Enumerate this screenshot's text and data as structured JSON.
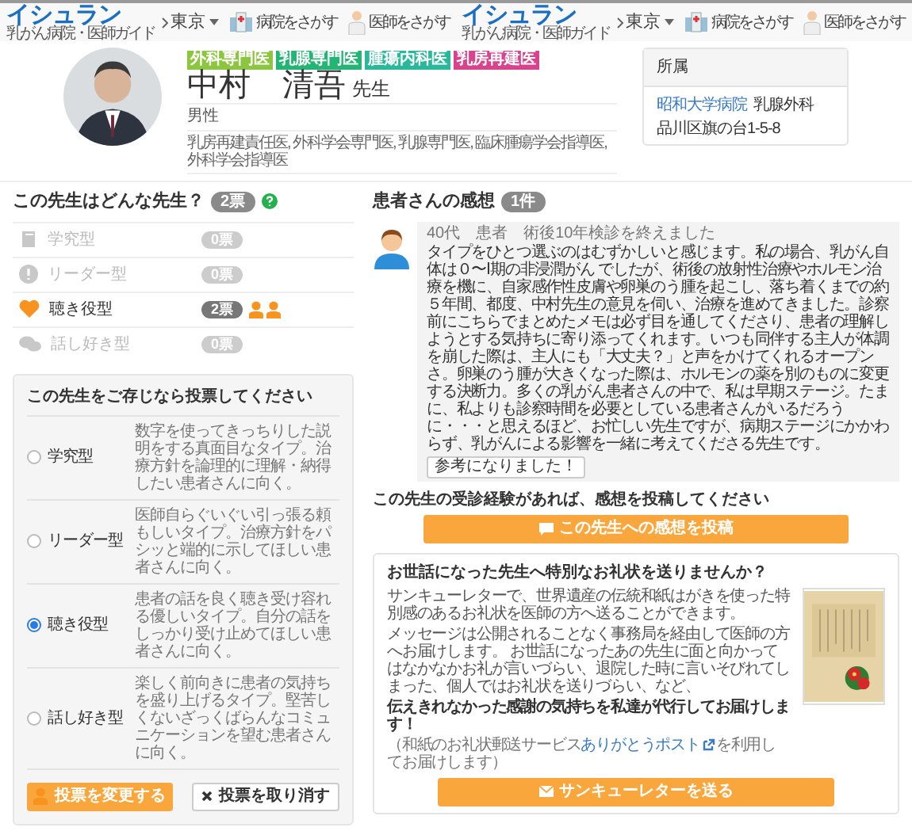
{
  "headers": [
    {
      "logo": "イシュラン",
      "tagline": "乳がん病院・医師ガイド",
      "region": "東京",
      "links": [
        "病院をさがす",
        "医師をさがす"
      ]
    },
    {
      "logo": "イシュラン",
      "tagline": "乳がん病院・医師ガイド",
      "region": "東京",
      "links": [
        "病院をさがす",
        "医師をさがす"
      ]
    }
  ],
  "profile": {
    "badges": [
      {
        "label": "外科専門医",
        "color": "#8cc63f"
      },
      {
        "label": "乳腺専門医",
        "color": "#22b573"
      },
      {
        "label": "腫瘍内科医",
        "color": "#29b89a"
      },
      {
        "label": "乳房再建医",
        "color": "#d9428c"
      }
    ],
    "name": "中村　清吾",
    "suffix": "先生",
    "gender": "男性",
    "qualifications": "乳房再建責任医, 外科学会専門医, 乳腺専門医, 臨床腫瘍学会指導医, 外科学会指導医"
  },
  "affiliation": {
    "title": "所属",
    "hospital": "昭和大学病院",
    "department": "乳腺外科",
    "address": "品川区旗の台1-5-8"
  },
  "types": {
    "title": "この先生はどんな先生？",
    "count": "2票",
    "items": [
      {
        "kind": "scholar",
        "label": "学究型",
        "count": "0票",
        "highlighted": false
      },
      {
        "kind": "leader",
        "label": "リーダー型",
        "count": "0票",
        "highlighted": false
      },
      {
        "kind": "listener",
        "label": "聴き役型",
        "count": "2票",
        "highlighted": true,
        "voters": [
          {
            "kind": "person"
          },
          {
            "kind": "person"
          }
        ]
      },
      {
        "kind": "talker",
        "label": "話し好き型",
        "count": "0票",
        "highlighted": false
      }
    ]
  },
  "vote": {
    "title": "この先生をご存じなら投票してください",
    "options": [
      {
        "label": "学究型",
        "description": "数字を使ってきっちりした説明をする真面目なタイプ。治療方針を論理的に理解・納得したい患者さんに向く。",
        "selected": false
      },
      {
        "label": "リーダー型",
        "description": "医師自らぐいぐい引っ張る頼もしいタイプ。治療方針をパシッと端的に示してほしい患者さんに向く。",
        "selected": false
      },
      {
        "label": "聴き役型",
        "description": "患者の話を良く聴き受け容れる優しいタイプ。自分の話をしっかり受け止めてほしい患者さんに向く。",
        "selected": true
      },
      {
        "label": "話し好き型",
        "description": "楽しく前向きに患者の気持ちを盛り上げるタイプ。堅苦しくないざっくばらんなコミュニケーションを望む患者さんに向く。",
        "selected": false
      }
    ],
    "change_button": "投票を変更する",
    "cancel_button": "投票を取り消す"
  },
  "reviews": {
    "title": "患者さんの感想",
    "count": "1件",
    "items": [
      {
        "meta": "40代　患者　術後10年検診を終えました",
        "body": "タイプをひとつ選ぶのはむずかしいと感じます。私の場合、乳がん自体は０〜Ⅰ期の非浸潤がん でしたが、術後の放射性治療やホルモン治療を機に、自家感作性皮膚や卵巣のう腫を起こし、落ち着くまでの約５年間、都度、中村先生の意見を伺い、治療を進めてきました。診察前にこちらでまとめたメモは必ず目を通してくださり、患者の理解しようとする気持ちに寄り添ってくれます。いつも同伴する主人が体調を崩した際は、主人にも「大丈夫？」と声をかけてくれるオープンさ。卵巣のう腫が大きくなった際は、ホルモンの薬を別のものに変更する決断力。多くの乳がん患者さんの中で、私は早期ステージ。たまに、私よりも診察時間を必要としている患者さんがいるだろうに・・・と思えるほど、お忙しい先生ですが、病期ステージにかかわらず、乳がんによる影響を一緒に考えてくださる先生です。",
        "helpful_button": "参考になりました！"
      }
    ],
    "post_prompt": "この先生の受診経験があれば、感想を投稿してください",
    "post_button": "この先生への感想を投稿"
  },
  "letter": {
    "title": "お世話になった先生へ特別なお礼状を送りませんか？",
    "paragraphs": [
      "サンキューレターで、世界遺産の伝統和紙はがきを使った特別感のあるお礼状を医師の方へ送ることができます。",
      "メッセージは公開されることなく事務局を経由して医師の方へお届けします。 お世話になったあの先生に面と向かってはなかなかお礼が言いづらい、退院した時に言いそびれてしまった、個人ではお礼状を送りづらい、など、"
    ],
    "emphasis": "伝えきれなかった感謝の気持ちを私達が代行してお届けします！",
    "note_before": "（和紙のお礼状郵送サービス",
    "note_link": "ありがとうポスト",
    "note_after": "を利用してお届けします）",
    "button": "サンキューレターを送る"
  }
}
